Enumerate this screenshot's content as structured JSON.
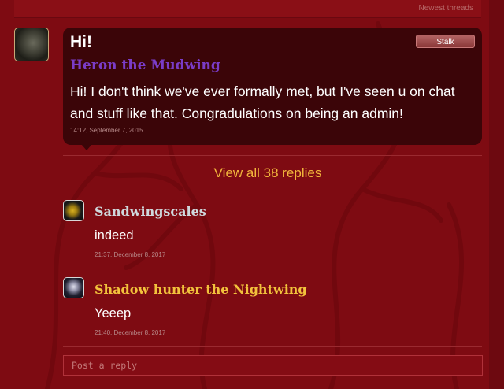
{
  "header": {
    "newest_threads": "Newest threads"
  },
  "post": {
    "title": "Hi!",
    "author": "Heron the Mudwing",
    "body": "Hi! I don't think we've ever formally met, but I've seen u on chat and stuff like that. Congradulations on being an admin!",
    "timestamp": "14:12, September 7, 2015",
    "stalk_label": "Stalk"
  },
  "view_all_label": "View all 38 replies",
  "replies": [
    {
      "author": "Sandwingscales",
      "text": "indeed",
      "timestamp": "21:37, December 8, 2017",
      "name_color": "#cfd8dc"
    },
    {
      "author": "Shadow hunter the Nightwing",
      "text": "Yeeep",
      "timestamp": "21:40, December 8, 2017",
      "name_color": "#f2c23c"
    }
  ],
  "reply_box": {
    "placeholder": "Post a reply"
  },
  "colors": {
    "background": "#7e0b12",
    "bubble": "#3b0508",
    "accent": "#f2b63c",
    "author_purple": "#7a3cc8"
  }
}
